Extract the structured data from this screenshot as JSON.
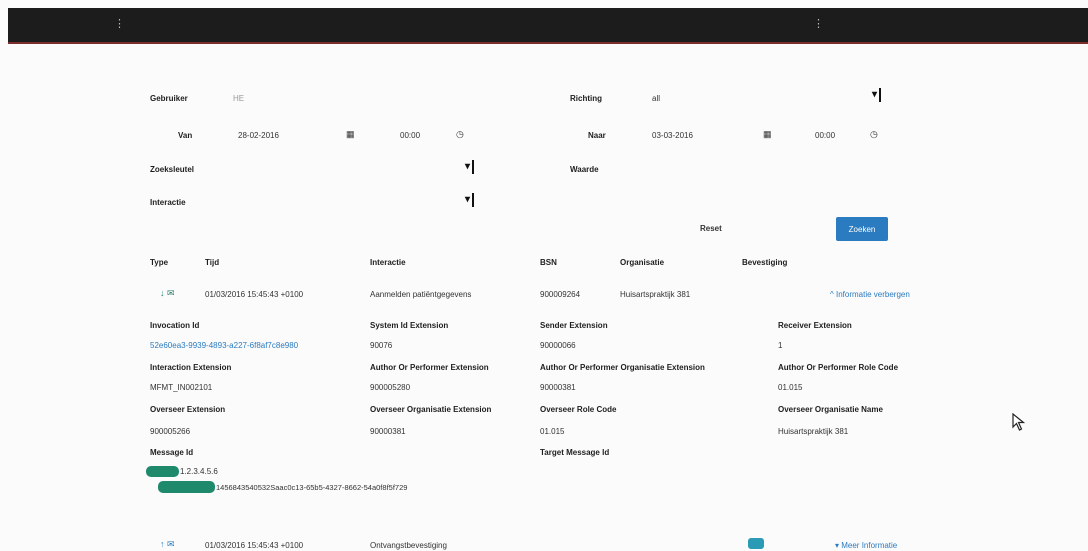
{
  "filters": {
    "gebruiker_label": "Gebruiker",
    "gebruiker_value": "HE",
    "richting_label": "Richting",
    "richting_value": "all",
    "van_label": "Van",
    "van_date": "28-02-2016",
    "van_time": "00:00",
    "naar_label": "Naar",
    "naar_date": "03-03-2016",
    "naar_time": "00:00",
    "zoeksleutel_label": "Zoeksleutel",
    "waarde_label": "Waarde",
    "interactie_label": "Interactie",
    "reset_label": "Reset",
    "zoeken_label": "Zoeken"
  },
  "table": {
    "headers": [
      "Type",
      "Tijd",
      "Interactie",
      "BSN",
      "Organisatie",
      "Bevestiging"
    ],
    "row1": {
      "time": "01/03/2016 15:45:43 +0100",
      "interactie": "Aanmelden patiëntgegevens",
      "bsn": "900009264",
      "organisatie": "Huisartspraktijk 381",
      "link": "^ Informatie verbergen"
    },
    "details": [
      {
        "label": "Invocation Id",
        "value": "52e60ea3-9939-4893-a227-6f8af7c8e980"
      },
      {
        "label": "System Id Extension",
        "value": "90076"
      },
      {
        "label": "Sender Extension",
        "value": "90000066"
      },
      {
        "label": "Receiver Extension",
        "value": "1"
      },
      {
        "label": "Interaction Extension",
        "value": "MFMT_IN002101"
      },
      {
        "label": "Author Or Performer Extension",
        "value": "900005280"
      },
      {
        "label": "Author Or Performer Organisatie Extension",
        "value": "90000381"
      },
      {
        "label": "Author Or Performer Role Code",
        "value": "01.015"
      },
      {
        "label": "Overseer Extension",
        "value": "900005266"
      },
      {
        "label": "Overseer Organisatie Extension",
        "value": "90000381"
      },
      {
        "label": "Overseer Role Code",
        "value": "01.015"
      },
      {
        "label": "Overseer Organisatie Name",
        "value": "Huisartspraktijk 381"
      }
    ],
    "message_id_label": "Message Id",
    "message_id_line1": "1.2.3.4.5.6",
    "message_id_line2": "1456843540532Saac0c13-65b5-4327-8662-54a0f8f5f729",
    "target_message_id_label": "Target Message Id",
    "row2": {
      "time": "01/03/2016 15:45:43 +0100",
      "interactie": "Ontvangstbevestiging",
      "link": "▾ Meer Informatie"
    }
  },
  "colors": {
    "accent": "#2b7bc0",
    "redacted": "#1f8a6b"
  }
}
